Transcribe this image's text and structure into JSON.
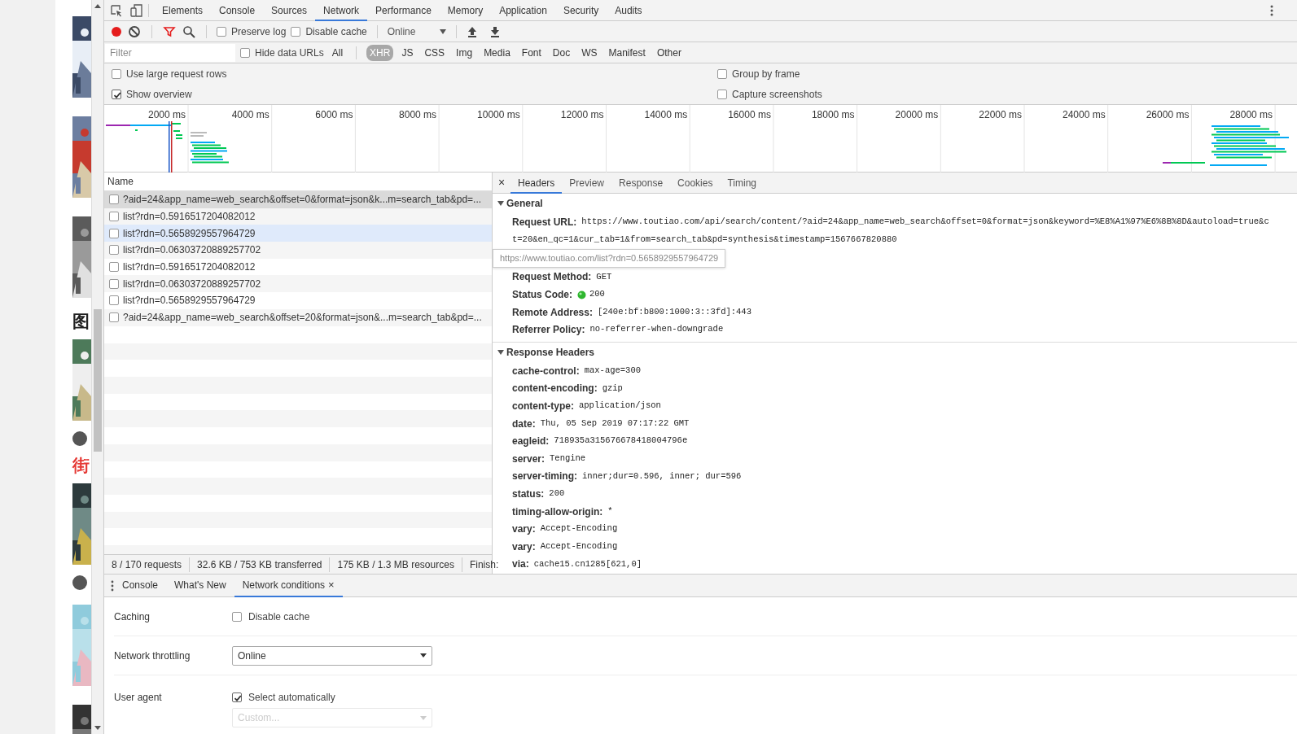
{
  "page": {
    "items": [
      {
        "kind": "picture"
      },
      {
        "kind": "picture"
      },
      {
        "kind": "picture"
      },
      {
        "kind": "heading",
        "text": "图",
        "highlighted": false
      },
      {
        "kind": "picture"
      },
      {
        "kind": "avatar"
      },
      {
        "kind": "heading",
        "text": "街",
        "highlighted": true
      },
      {
        "kind": "picture"
      },
      {
        "kind": "avatar"
      },
      {
        "kind": "picture"
      },
      {
        "kind": "picture"
      }
    ]
  },
  "tabs": [
    {
      "label": "Elements",
      "selected": false
    },
    {
      "label": "Console",
      "selected": false
    },
    {
      "label": "Sources",
      "selected": false
    },
    {
      "label": "Network",
      "selected": true
    },
    {
      "label": "Performance",
      "selected": false
    },
    {
      "label": "Memory",
      "selected": false
    },
    {
      "label": "Application",
      "selected": false
    },
    {
      "label": "Security",
      "selected": false
    },
    {
      "label": "Audits",
      "selected": false
    }
  ],
  "toolbar": {
    "recording": true,
    "preserve_log": {
      "label": "Preserve log",
      "checked": false
    },
    "disable_cache": {
      "label": "Disable cache",
      "checked": false
    },
    "throttling": "Online"
  },
  "filter": {
    "placeholder": "Filter",
    "hide_data_urls": {
      "label": "Hide data URLs",
      "checked": false
    },
    "types": [
      {
        "label": "All",
        "selected": false
      },
      {
        "label": "XHR",
        "selected": true
      },
      {
        "label": "JS",
        "selected": false
      },
      {
        "label": "CSS",
        "selected": false
      },
      {
        "label": "Img",
        "selected": false
      },
      {
        "label": "Media",
        "selected": false
      },
      {
        "label": "Font",
        "selected": false
      },
      {
        "label": "Doc",
        "selected": false
      },
      {
        "label": "WS",
        "selected": false
      },
      {
        "label": "Manifest",
        "selected": false
      },
      {
        "label": "Other",
        "selected": false
      }
    ]
  },
  "settings": [
    {
      "label": "Use large request rows",
      "checked": false
    },
    {
      "label": "Group by frame",
      "checked": false
    },
    {
      "label": "Show overview",
      "checked": true
    },
    {
      "label": "Capture screenshots",
      "checked": false
    }
  ],
  "overview": {
    "ticks": [
      "2000 ms",
      "4000 ms",
      "6000 ms",
      "8000 ms",
      "10000 ms",
      "12000 ms",
      "14000 ms",
      "16000 ms",
      "18000 ms",
      "20000 ms",
      "22000 ms",
      "24000 ms",
      "26000 ms",
      "28000 ms"
    ]
  },
  "requests": {
    "column": "Name",
    "rows": [
      {
        "name": "?aid=24&app_name=web_search&offset=0&format=json&k...m=search_tab&pd=...",
        "selected": true,
        "hovered": false
      },
      {
        "name": "list?rdn=0.5916517204082012",
        "selected": false,
        "hovered": false
      },
      {
        "name": "list?rdn=0.5658929557964729",
        "selected": false,
        "hovered": true
      },
      {
        "name": "list?rdn=0.06303720889257702",
        "selected": false,
        "hovered": false
      },
      {
        "name": "list?rdn=0.5916517204082012",
        "selected": false,
        "hovered": false
      },
      {
        "name": "list?rdn=0.06303720889257702",
        "selected": false,
        "hovered": false
      },
      {
        "name": "list?rdn=0.5658929557964729",
        "selected": false,
        "hovered": false
      },
      {
        "name": "?aid=24&app_name=web_search&offset=20&format=json&...m=search_tab&pd=...",
        "selected": false,
        "hovered": false
      }
    ]
  },
  "status_bar": [
    "8 / 170 requests",
    "32.6 KB / 753 KB transferred",
    "175 KB / 1.3 MB resources",
    "Finish:"
  ],
  "details": {
    "close": "×",
    "tabs": [
      {
        "label": "Headers",
        "selected": true
      },
      {
        "label": "Preview",
        "selected": false
      },
      {
        "label": "Response",
        "selected": false
      },
      {
        "label": "Cookies",
        "selected": false
      },
      {
        "label": "Timing",
        "selected": false
      }
    ],
    "tooltip": "https://www.toutiao.com/list?rdn=0.5658929557964729",
    "sections": [
      {
        "title": "General",
        "expanded": true,
        "fields": [
          {
            "kind": "url",
            "name": "Request URL:",
            "lines": [
              "https://www.toutiao.com/api/search/content/?aid=24&app_name=web_search&offset=0&format=json&keyword=%E8%A1%97%E6%8B%8D&autoload=true&c",
              "t=20&en_qc=1&cur_tab=1&from=search_tab&pd=synthesis&timestamp=1567667820880"
            ]
          },
          {
            "kind": "text",
            "name": "Request Method:",
            "value": "GET"
          },
          {
            "kind": "status",
            "name": "Status Code:",
            "value": "200"
          },
          {
            "kind": "text",
            "name": "Remote Address:",
            "value": "[240e:bf:b800:1000:3::3fd]:443"
          },
          {
            "kind": "text",
            "name": "Referrer Policy:",
            "value": "no-referrer-when-downgrade"
          }
        ]
      },
      {
        "title": "Response Headers",
        "expanded": true,
        "fields": [
          {
            "kind": "text",
            "name": "cache-control:",
            "value": "max-age=300"
          },
          {
            "kind": "text",
            "name": "content-encoding:",
            "value": "gzip"
          },
          {
            "kind": "text",
            "name": "content-type:",
            "value": "application/json"
          },
          {
            "kind": "text",
            "name": "date:",
            "value": "Thu, 05 Sep 2019 07:17:22 GMT"
          },
          {
            "kind": "text",
            "name": "eagleid:",
            "value": "718935a315676678418004796e"
          },
          {
            "kind": "text",
            "name": "server:",
            "value": "Tengine"
          },
          {
            "kind": "text",
            "name": "server-timing:",
            "value": "inner;dur=0.596, inner; dur=596"
          },
          {
            "kind": "text",
            "name": "status:",
            "value": "200"
          },
          {
            "kind": "text",
            "name": "timing-allow-origin:",
            "value": "*"
          },
          {
            "kind": "text",
            "name": "vary:",
            "value": "Accept-Encoding"
          },
          {
            "kind": "text",
            "name": "vary:",
            "value": "Accept-Encoding"
          },
          {
            "kind": "text",
            "name": "via:",
            "value": "cache15.cn1285[621,0]"
          }
        ]
      }
    ]
  },
  "drawer": {
    "tabs": [
      {
        "label": "Console",
        "selected": false,
        "closable": false
      },
      {
        "label": "What's New",
        "selected": false,
        "closable": false
      },
      {
        "label": "Network conditions",
        "selected": true,
        "closable": true
      }
    ],
    "close": "×",
    "rows": [
      {
        "label": "Caching",
        "kind": "checkbox",
        "text": "Disable cache",
        "checked": false
      },
      {
        "label": "Network throttling",
        "kind": "select",
        "value": "Online",
        "disabled": false
      },
      {
        "label": "User agent",
        "kind": "checkbox",
        "text": "Select automatically",
        "checked": true
      },
      {
        "label": "",
        "kind": "select",
        "placeholder": "Custom...",
        "disabled": true
      }
    ]
  }
}
